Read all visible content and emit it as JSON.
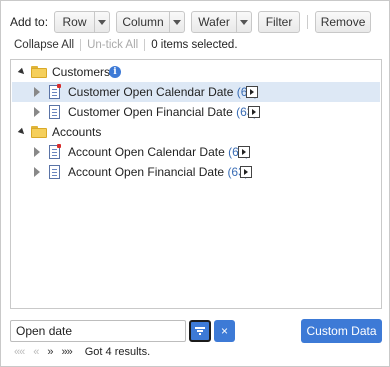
{
  "toolbar": {
    "add_to_label": "Add to:",
    "row_label": "Row",
    "column_label": "Column",
    "wafer_label": "Wafer",
    "filter_label": "Filter",
    "remove_label": "Remove"
  },
  "selection": {
    "collapse_all": "Collapse All",
    "untick_all": "Un-tick All",
    "status": "0 items selected."
  },
  "tree": {
    "groups": [
      {
        "label": "Customers",
        "info_icon": "info-icon",
        "items": [
          {
            "label": "Customer Open Calendar Date",
            "count": "(63)",
            "selected": true
          },
          {
            "label": "Customer Open Financial Date",
            "count": "(63)",
            "selected": false
          }
        ]
      },
      {
        "label": "Accounts",
        "items": [
          {
            "label": "Account Open Calendar Date",
            "count": "(63)",
            "selected": false
          },
          {
            "label": "Account Open Financial Date",
            "count": "(63)",
            "selected": false
          }
        ]
      }
    ]
  },
  "search": {
    "value": "Open date"
  },
  "buttons": {
    "custom_data": "Custom Data",
    "clear": "×"
  },
  "pager": {
    "first": "««",
    "prev": "«",
    "next": "»",
    "last": "»»",
    "result": "Got 4 results."
  },
  "colors": {
    "accent": "#3d7ad6",
    "selected_row": "#dde8f5",
    "count": "#3a6db5"
  }
}
